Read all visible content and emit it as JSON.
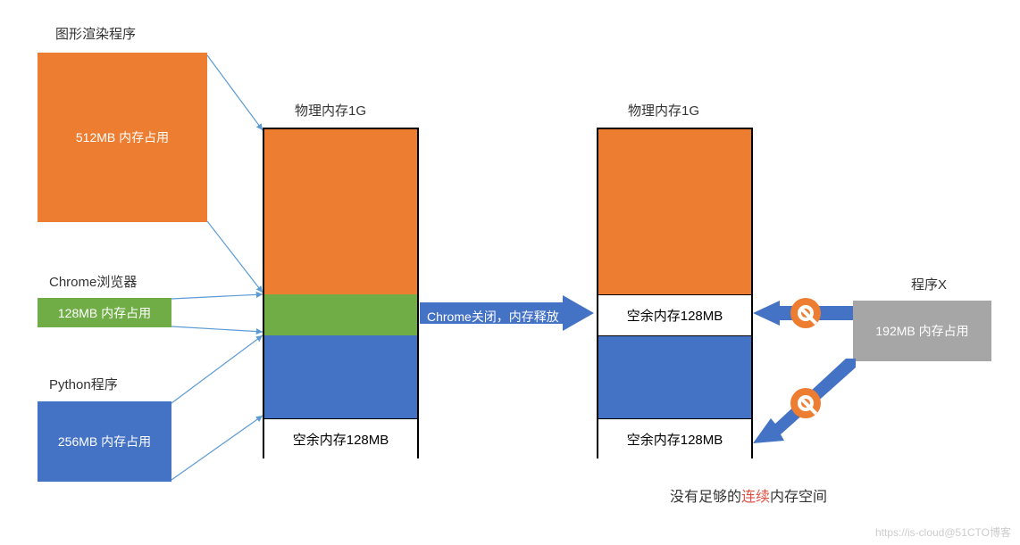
{
  "left_processes": {
    "gfx": {
      "title": "图形渲染程序",
      "usage": "512MB 内存占用"
    },
    "chrome": {
      "title": "Chrome浏览器",
      "usage": "128MB 内存占用"
    },
    "python": {
      "title": "Python程序",
      "usage": "256MB 内存占用"
    }
  },
  "stack1": {
    "title": "物理内存1G",
    "free_label": "空余内存128MB"
  },
  "arrow_close": "Chrome关闭，内存释放",
  "stack2": {
    "title": "物理内存1G",
    "free_top": "空余内存128MB",
    "free_bottom": "空余内存128MB"
  },
  "programX": {
    "title": "程序X",
    "usage": "192MB 内存占用"
  },
  "conclusion": {
    "prefix": "没有足够的",
    "highlight": "连续",
    "suffix": "内存空间"
  },
  "watermark": "https://is-cloud@51CTO博客",
  "chart_data": {
    "type": "table",
    "description": "Memory fragmentation diagram showing physical memory layout before and after Chrome is closed",
    "physical_memory_total": "1G",
    "processes": [
      {
        "name": "图形渲染程序",
        "size_mb": 512,
        "color": "#ED7D31"
      },
      {
        "name": "Chrome浏览器",
        "size_mb": 128,
        "color": "#70AD47"
      },
      {
        "name": "Python程序",
        "size_mb": 256,
        "color": "#4472C4"
      }
    ],
    "state_before": [
      {
        "segment": "图形渲染程序",
        "size_mb": 512
      },
      {
        "segment": "Chrome浏览器",
        "size_mb": 128
      },
      {
        "segment": "Python程序",
        "size_mb": 256
      },
      {
        "segment": "空余内存",
        "size_mb": 128
      }
    ],
    "event": "Chrome关闭，内存释放",
    "state_after": [
      {
        "segment": "图形渲染程序",
        "size_mb": 512
      },
      {
        "segment": "空余内存",
        "size_mb": 128
      },
      {
        "segment": "Python程序",
        "size_mb": 256
      },
      {
        "segment": "空余内存",
        "size_mb": 128
      }
    ],
    "incoming_process": {
      "name": "程序X",
      "size_mb": 192,
      "can_allocate": false
    },
    "conclusion": "没有足够的连续内存空间"
  }
}
